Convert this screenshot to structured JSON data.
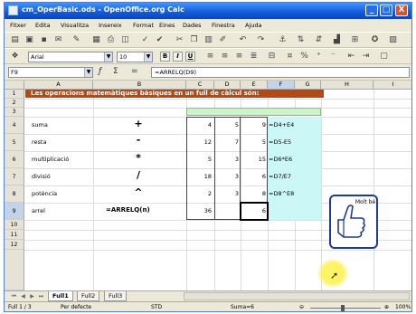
{
  "window": {
    "title": "cm_OperBasic.ods - OpenOffice.org Calc",
    "controls": {
      "minimize": "_",
      "maximize": "□",
      "close": "X"
    }
  },
  "menu": [
    "Fitxer",
    "Edita",
    "Visualitza",
    "Insereix",
    "Format",
    "Eines",
    "Dades",
    "Finestra",
    "Ajuda"
  ],
  "toolbar_format": {
    "font_name": "Arial",
    "font_size": "10"
  },
  "formula_bar": {
    "cell_ref": "F9",
    "formula": "=ARRELQ(D9)"
  },
  "columns": [
    "A",
    "B",
    "C",
    "D",
    "E",
    "F",
    "G",
    "H",
    "I"
  ],
  "rows": [
    "1",
    "2",
    "3",
    "4",
    "5",
    "6",
    "7",
    "8",
    "9",
    "10",
    "11",
    "12"
  ],
  "sheet": {
    "banner": "Les operacions matemàtiques bàsiques en un full de càlcul són:",
    "operations": [
      {
        "name": "suma",
        "symbol": "+",
        "d": "4",
        "e": "5",
        "f": "9",
        "g": "=D4+E4"
      },
      {
        "name": "resta",
        "symbol": "-",
        "d": "12",
        "e": "7",
        "f": "5",
        "g": "=D5-E5"
      },
      {
        "name": "multiplicació",
        "symbol": "*",
        "d": "5",
        "e": "3",
        "f": "15",
        "g": "=D6*E6"
      },
      {
        "name": "divisió",
        "symbol": "/",
        "d": "18",
        "e": "3",
        "f": "6",
        "g": "=D7/E7"
      },
      {
        "name": "potència",
        "symbol": "^",
        "d": "2",
        "e": "3",
        "f": "8",
        "g": "=D8^E8"
      },
      {
        "name": "arrel",
        "symbol": "=ARRELQ(n)",
        "d": "36",
        "e": "",
        "f": "6",
        "g": ""
      }
    ],
    "badge_text": "Molt bé"
  },
  "tabs": [
    "Full1",
    "Full2",
    "Full3"
  ],
  "status": {
    "sheet": "Full 1 / 3",
    "style": "Per defecte",
    "mode": "STD",
    "sum": "Suma=6",
    "zoom": "100%"
  },
  "colors": {
    "banner": "#b14a14",
    "title_bar": "#1559d8",
    "header_green": "#ccf2cc",
    "result_cyan": "#ccf7f7"
  }
}
